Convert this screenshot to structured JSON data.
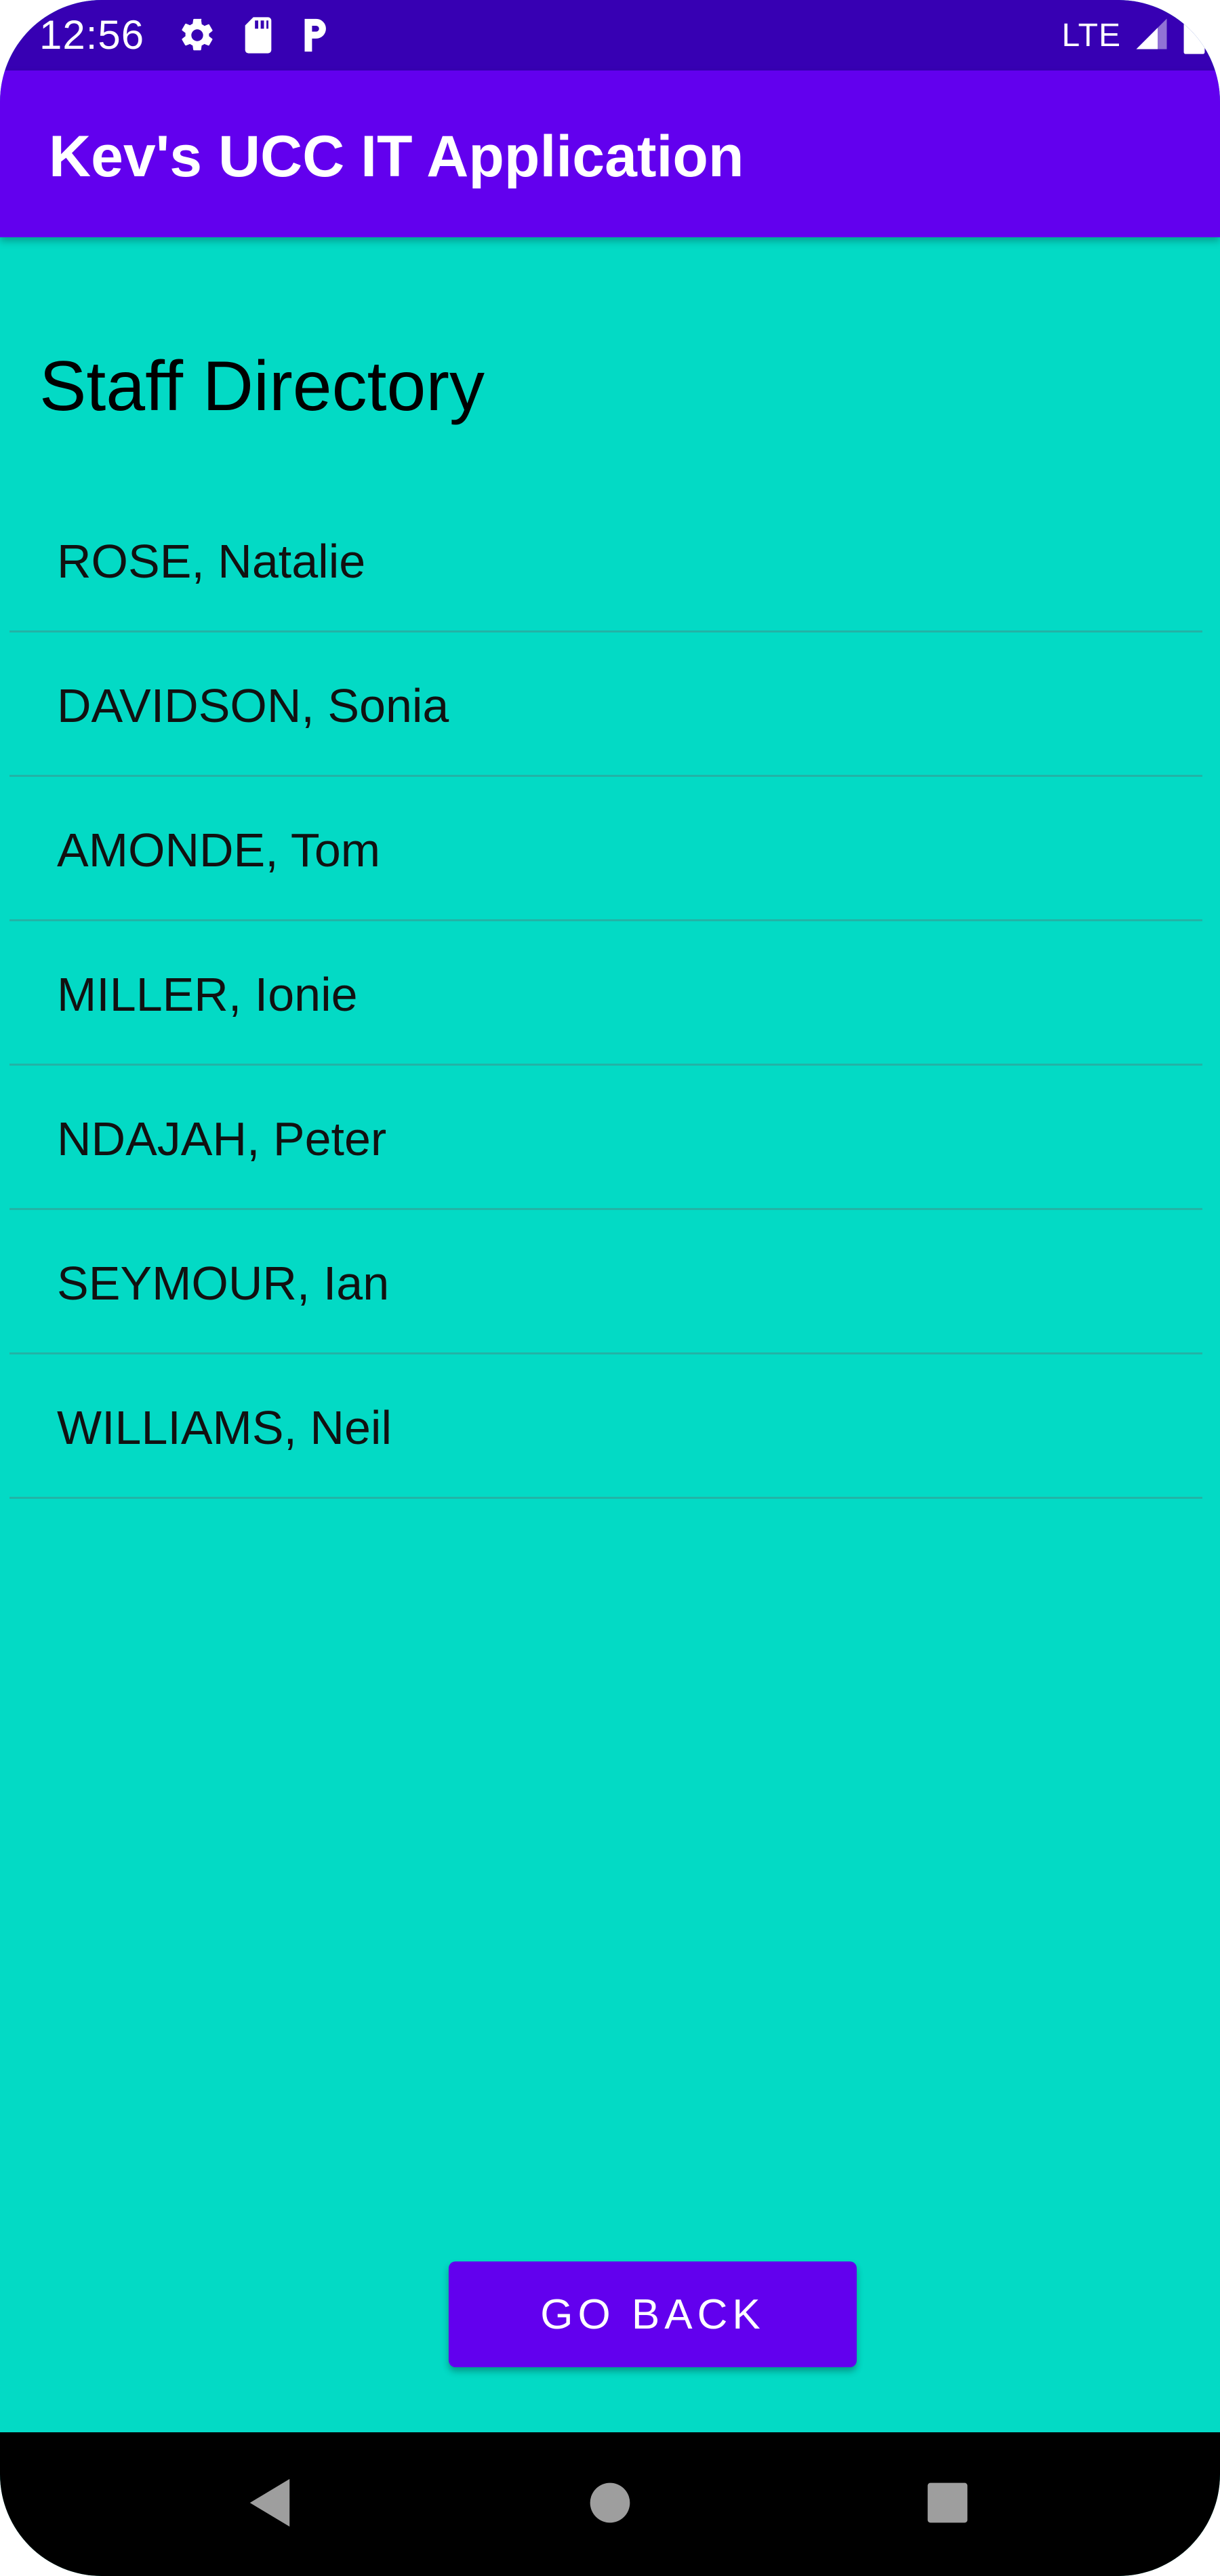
{
  "status_bar": {
    "time": "12:56",
    "left_icons": [
      "gear-icon",
      "sd-card-icon",
      "parking-icon"
    ],
    "network": "LTE",
    "right_icons": [
      "signal-icon",
      "battery-icon"
    ],
    "color": "#3700b3"
  },
  "app_bar": {
    "title": "Kev's UCC IT Application",
    "color": "#6200ee"
  },
  "main": {
    "heading": "Staff Directory",
    "background": "#03dac5",
    "staff": [
      {
        "name": "ROSE, Natalie"
      },
      {
        "name": "DAVIDSON, Sonia"
      },
      {
        "name": "AMONDE, Tom"
      },
      {
        "name": "MILLER, Ionie"
      },
      {
        "name": "NDAJAH, Peter"
      },
      {
        "name": "SEYMOUR, Ian"
      },
      {
        "name": "WILLIAMS, Neil"
      }
    ],
    "go_back_label": "GO BACK"
  },
  "nav_bar": {
    "buttons": [
      "back-icon",
      "home-icon",
      "recents-icon"
    ]
  }
}
